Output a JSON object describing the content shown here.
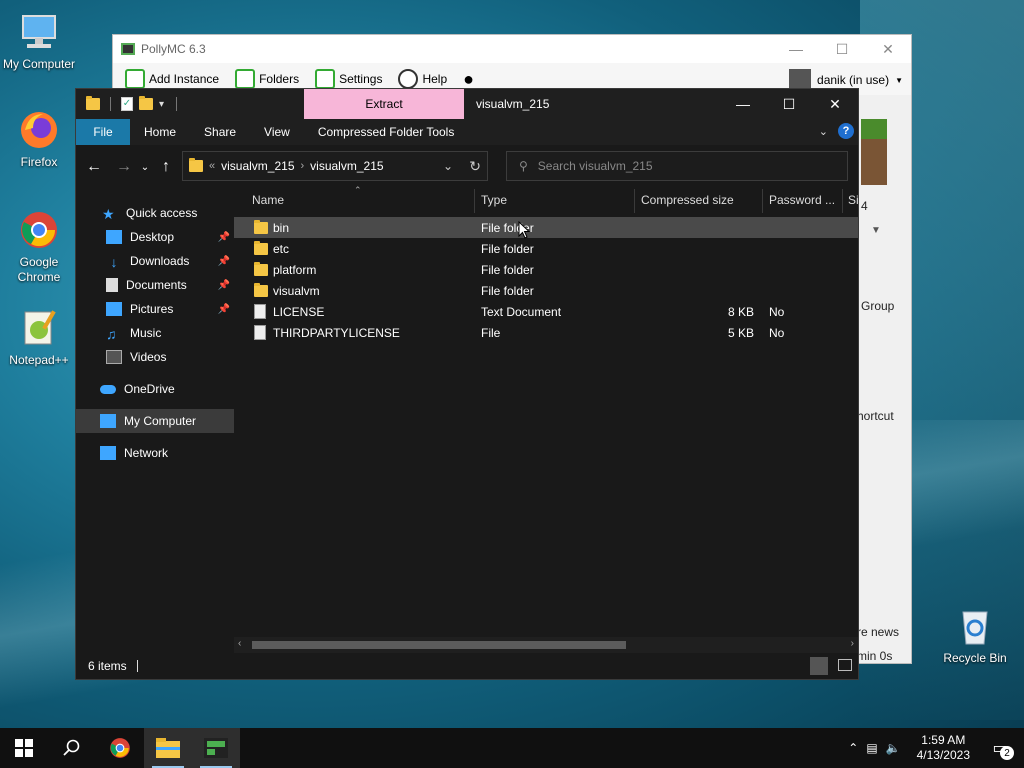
{
  "desktop": {
    "icons": [
      {
        "label": "My Computer",
        "icon": "computer-icon"
      },
      {
        "label": "Firefox",
        "icon": "firefox-icon"
      },
      {
        "label": "Google Chrome",
        "icon": "chrome-icon"
      },
      {
        "label": "Notepad++",
        "icon": "notepadpp-icon"
      },
      {
        "label": "Recycle Bin",
        "icon": "recycle-bin-icon"
      }
    ]
  },
  "pollymc": {
    "title": "PollyMC 6.3",
    "toolbar": [
      "Add Instance",
      "Folders",
      "Settings",
      "Help"
    ],
    "user": "danik (in use)",
    "side_texts": [
      "4",
      "Group",
      "hortcut",
      "re news",
      "min 0s"
    ]
  },
  "explorer": {
    "extract_tab": "Extract",
    "window_title": "visualvm_215",
    "ribbon_tabs": [
      "File",
      "Home",
      "Share",
      "View",
      "Compressed Folder Tools"
    ],
    "address": {
      "overflow": "«",
      "crumbs": [
        "visualvm_215",
        "visualvm_215"
      ]
    },
    "search_placeholder": "Search visualvm_215",
    "nav": {
      "quick_access": "Quick access",
      "desktop": "Desktop",
      "downloads": "Downloads",
      "documents": "Documents",
      "pictures": "Pictures",
      "music": "Music",
      "videos": "Videos",
      "onedrive": "OneDrive",
      "my_computer": "My Computer",
      "network": "Network"
    },
    "columns": [
      "Name",
      "Type",
      "Compressed size",
      "Password ...",
      "Si"
    ],
    "files": [
      {
        "name": "bin",
        "type": "File folder",
        "size": "",
        "password": ""
      },
      {
        "name": "etc",
        "type": "File folder",
        "size": "",
        "password": ""
      },
      {
        "name": "platform",
        "type": "File folder",
        "size": "",
        "password": ""
      },
      {
        "name": "visualvm",
        "type": "File folder",
        "size": "",
        "password": ""
      },
      {
        "name": "LICENSE",
        "type": "Text Document",
        "size": "8 KB",
        "password": "No"
      },
      {
        "name": "THIRDPARTYLICENSE",
        "type": "File",
        "size": "5 KB",
        "password": "No"
      }
    ],
    "status": "6 items"
  },
  "taskbar": {
    "time": "1:59 AM",
    "date": "4/13/2023",
    "notifications": "2"
  }
}
